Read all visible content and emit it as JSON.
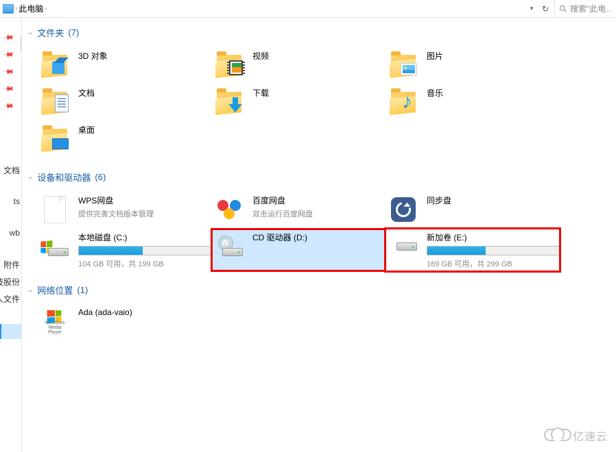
{
  "breadcrumb": {
    "location": "此电脑"
  },
  "search": {
    "placeholder": "搜索\"此电…"
  },
  "sidebar": {
    "items": [
      {
        "label": ""
      },
      {
        "label": ""
      },
      {
        "label": ""
      },
      {
        "label": ""
      },
      {
        "label": ""
      },
      {
        "label": "文档"
      },
      {
        "label": ""
      },
      {
        "label": "ts"
      },
      {
        "label": ""
      },
      {
        "label": "wb"
      },
      {
        "label": ""
      },
      {
        "label": "附件"
      },
      {
        "label": "科技股份"
      },
      {
        "label": "人文件"
      }
    ]
  },
  "sections": {
    "folders": {
      "title": "文件夹",
      "count": "(7)"
    },
    "drives": {
      "title": "设备和驱动器",
      "count": "(6)"
    },
    "network": {
      "title": "网络位置",
      "count": "(1)"
    }
  },
  "folders": [
    {
      "label": "3D 对象"
    },
    {
      "label": "视频"
    },
    {
      "label": "图片"
    },
    {
      "label": "文档"
    },
    {
      "label": "下载"
    },
    {
      "label": "音乐"
    },
    {
      "label": "桌面"
    }
  ],
  "drives": [
    {
      "label": "WPS网盘",
      "sub": "提供完善文档版本管理",
      "type": "wps"
    },
    {
      "label": "百度网盘",
      "sub": "双击运行百度网盘",
      "type": "baidu"
    },
    {
      "label": "同步盘",
      "sub": "",
      "type": "sync"
    },
    {
      "label": "本地磁盘 (C:)",
      "sub": "104 GB 可用，共 199 GB",
      "type": "hdd",
      "fill": 48
    },
    {
      "label": "CD 驱动器 (D:)",
      "sub": "",
      "type": "cd",
      "highlighted": true,
      "selected": true
    },
    {
      "label": "新加卷 (E:)",
      "sub": "169 GB 可用，共 299 GB",
      "type": "hdd",
      "fill": 44,
      "highlighted": true
    }
  ],
  "network": [
    {
      "label": "Ada (ada-vaio)",
      "sub": ""
    }
  ],
  "wmp": {
    "line1": "Windows",
    "line2": "Media Player"
  },
  "watermark": "亿速云"
}
